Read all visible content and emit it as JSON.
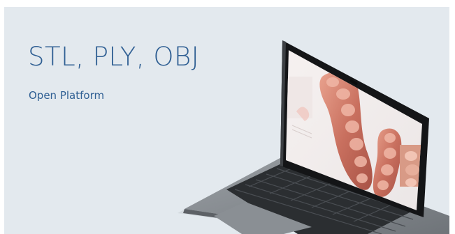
{
  "banner": {
    "headline": "STL, PLY, OBJ",
    "subline": "Open Platform"
  },
  "colors": {
    "background": "#e3e9ee",
    "headline_text": "#2f5f93",
    "laptop_body": "#7e8388",
    "screen_bezel": "#141517",
    "model_tissue": "#c46a5c"
  },
  "illustration": {
    "subject": "laptop-showing-3d-dental-scan"
  }
}
